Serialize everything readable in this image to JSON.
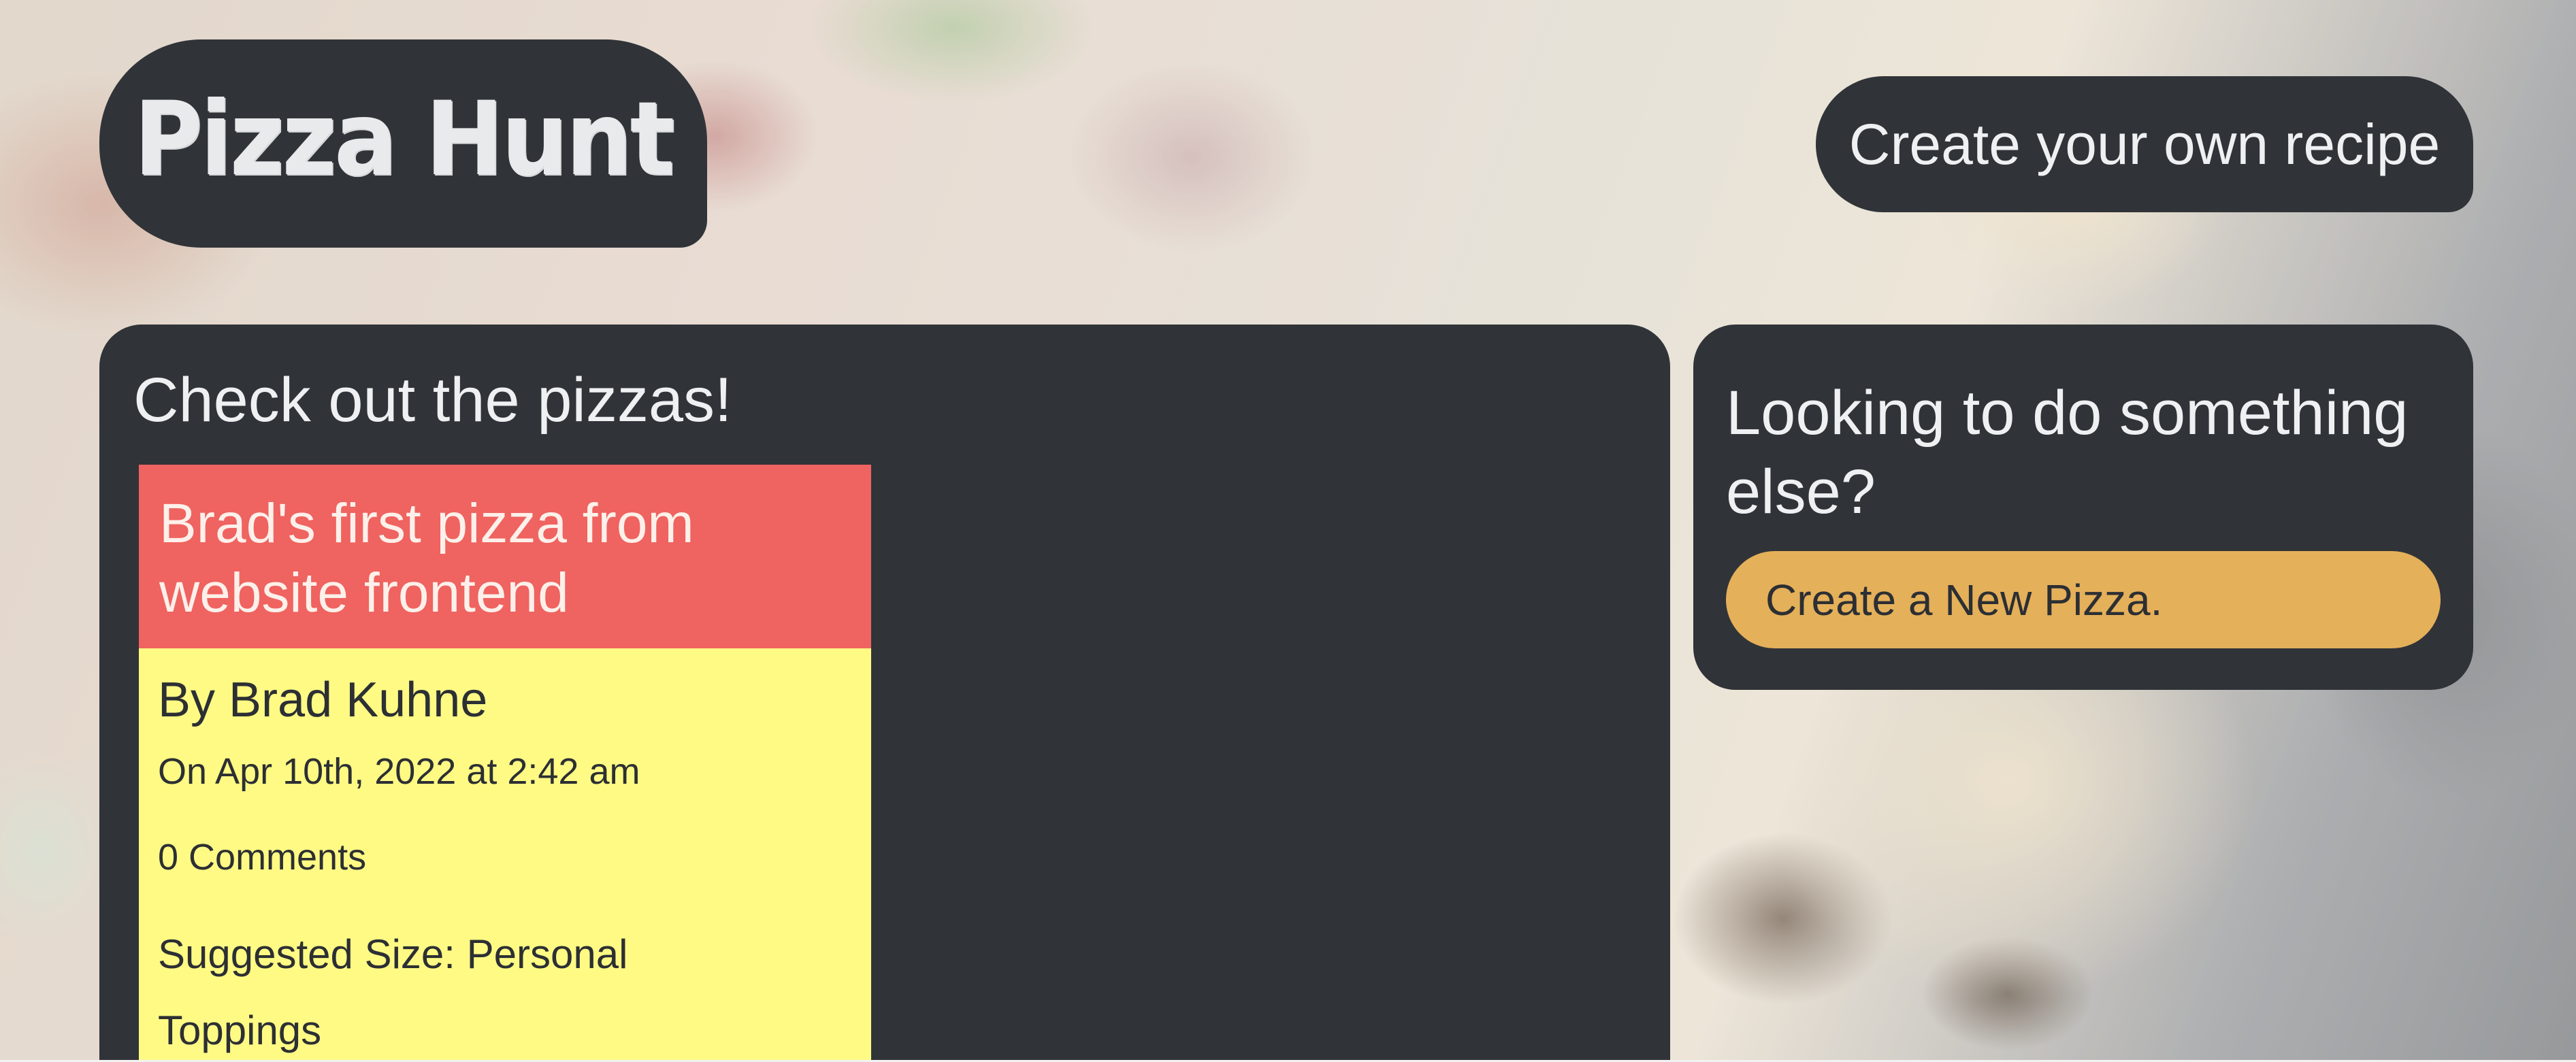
{
  "header": {
    "logo_text": "Pizza Hunt",
    "recipe_link": "Create your own recipe"
  },
  "main": {
    "title": "Check out the pizzas!",
    "pizzas": [
      {
        "name": "Brad's first pizza from website frontend",
        "author": "By Brad Kuhne",
        "date": "On Apr 10th, 2022 at 2:42 am",
        "comments": "0 Comments",
        "size": "Suggested Size: Personal",
        "toppings_label": "Toppings"
      }
    ]
  },
  "sidebar": {
    "title": "Looking to do something else?",
    "button_label": "Create a New Pizza."
  },
  "colors": {
    "panel": "#303438",
    "card_header": "#ef6360",
    "card_body": "#fffa84",
    "button": "#e5b05a"
  }
}
